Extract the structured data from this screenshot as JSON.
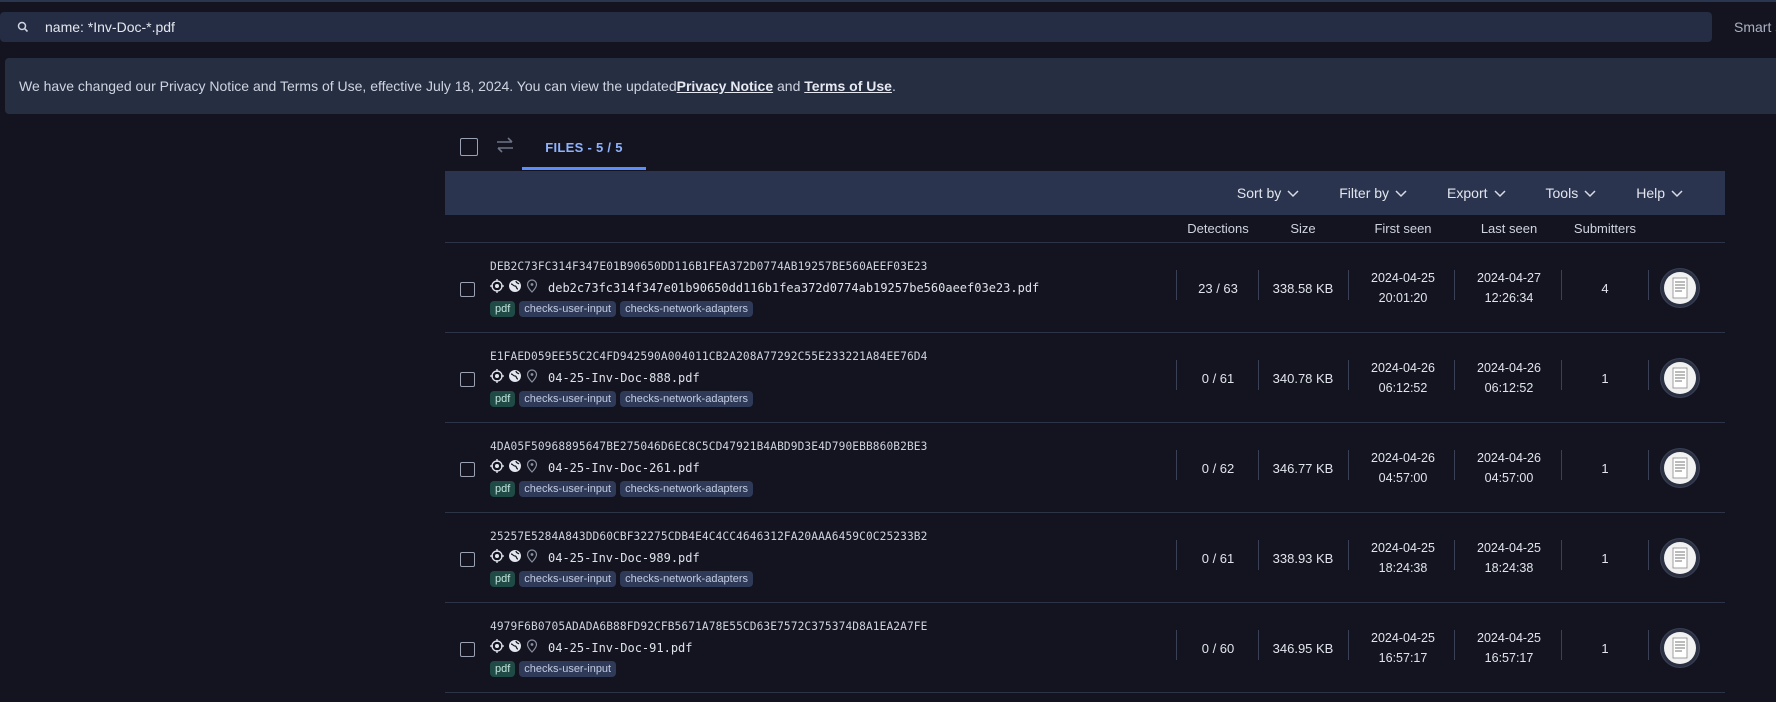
{
  "search": {
    "value": "name: *Inv-Doc-*.pdf",
    "smart_label": "Smart s"
  },
  "notice": {
    "text_before": "We have changed our Privacy Notice and Terms of Use, effective July 18, 2024. You can view the updated ",
    "privacy_link": "Privacy Notice",
    "and": " and ",
    "terms_link": "Terms of Use",
    "period": "."
  },
  "tabs": {
    "files": "FILES - 5 / 5"
  },
  "toolbar": {
    "sort": "Sort by",
    "filter": "Filter by",
    "export": "Export",
    "tools": "Tools",
    "help": "Help"
  },
  "columns": {
    "detections": "Detections",
    "size": "Size",
    "first_seen": "First seen",
    "last_seen": "Last seen",
    "submitters": "Submitters"
  },
  "rows": [
    {
      "hash": "DEB2C73FC314F347E01B90650DD116B1FEA372D0774AB19257BE560AEEF03E23",
      "name": "deb2c73fc314f347e01b90650dd116b1fea372d0774ab19257be560aeef03e23.pdf",
      "tags": [
        "pdf",
        "checks-user-input",
        "checks-network-adapters"
      ],
      "detections": "23 / 63",
      "size": "338.58 KB",
      "first_date": "2024-04-25",
      "first_time": "20:01:20",
      "last_date": "2024-04-27",
      "last_time": "12:26:34",
      "submitters": "4"
    },
    {
      "hash": "E1FAED059EE55C2C4FD942590A004011CB2A208A77292C55E233221A84EE76D4",
      "name": "04-25-Inv-Doc-888.pdf",
      "tags": [
        "pdf",
        "checks-user-input",
        "checks-network-adapters"
      ],
      "detections": "0 / 61",
      "size": "340.78 KB",
      "first_date": "2024-04-26",
      "first_time": "06:12:52",
      "last_date": "2024-04-26",
      "last_time": "06:12:52",
      "submitters": "1"
    },
    {
      "hash": "4DA05F50968895647BE275046D6EC8C5CD47921B4ABD9D3E4D790EBB860B2BE3",
      "name": "04-25-Inv-Doc-261.pdf",
      "tags": [
        "pdf",
        "checks-user-input",
        "checks-network-adapters"
      ],
      "detections": "0 / 62",
      "size": "346.77 KB",
      "first_date": "2024-04-26",
      "first_time": "04:57:00",
      "last_date": "2024-04-26",
      "last_time": "04:57:00",
      "submitters": "1"
    },
    {
      "hash": "25257E5284A843DD60CBF32275CDB4E4C4CC4646312FA20AAA6459C0C25233B2",
      "name": "04-25-Inv-Doc-989.pdf",
      "tags": [
        "pdf",
        "checks-user-input",
        "checks-network-adapters"
      ],
      "detections": "0 / 61",
      "size": "338.93 KB",
      "first_date": "2024-04-25",
      "first_time": "18:24:38",
      "last_date": "2024-04-25",
      "last_time": "18:24:38",
      "submitters": "1"
    },
    {
      "hash": "4979F6B0705ADADA6B88FD92CFB5671A78E55CD63E7572C375374D8A1EA2A7FE",
      "name": "04-25-Inv-Doc-91.pdf",
      "tags": [
        "pdf",
        "checks-user-input"
      ],
      "detections": "0 / 60",
      "size": "346.95 KB",
      "first_date": "2024-04-25",
      "first_time": "16:57:17",
      "last_date": "2024-04-25",
      "last_time": "16:57:17",
      "submitters": "1"
    }
  ]
}
